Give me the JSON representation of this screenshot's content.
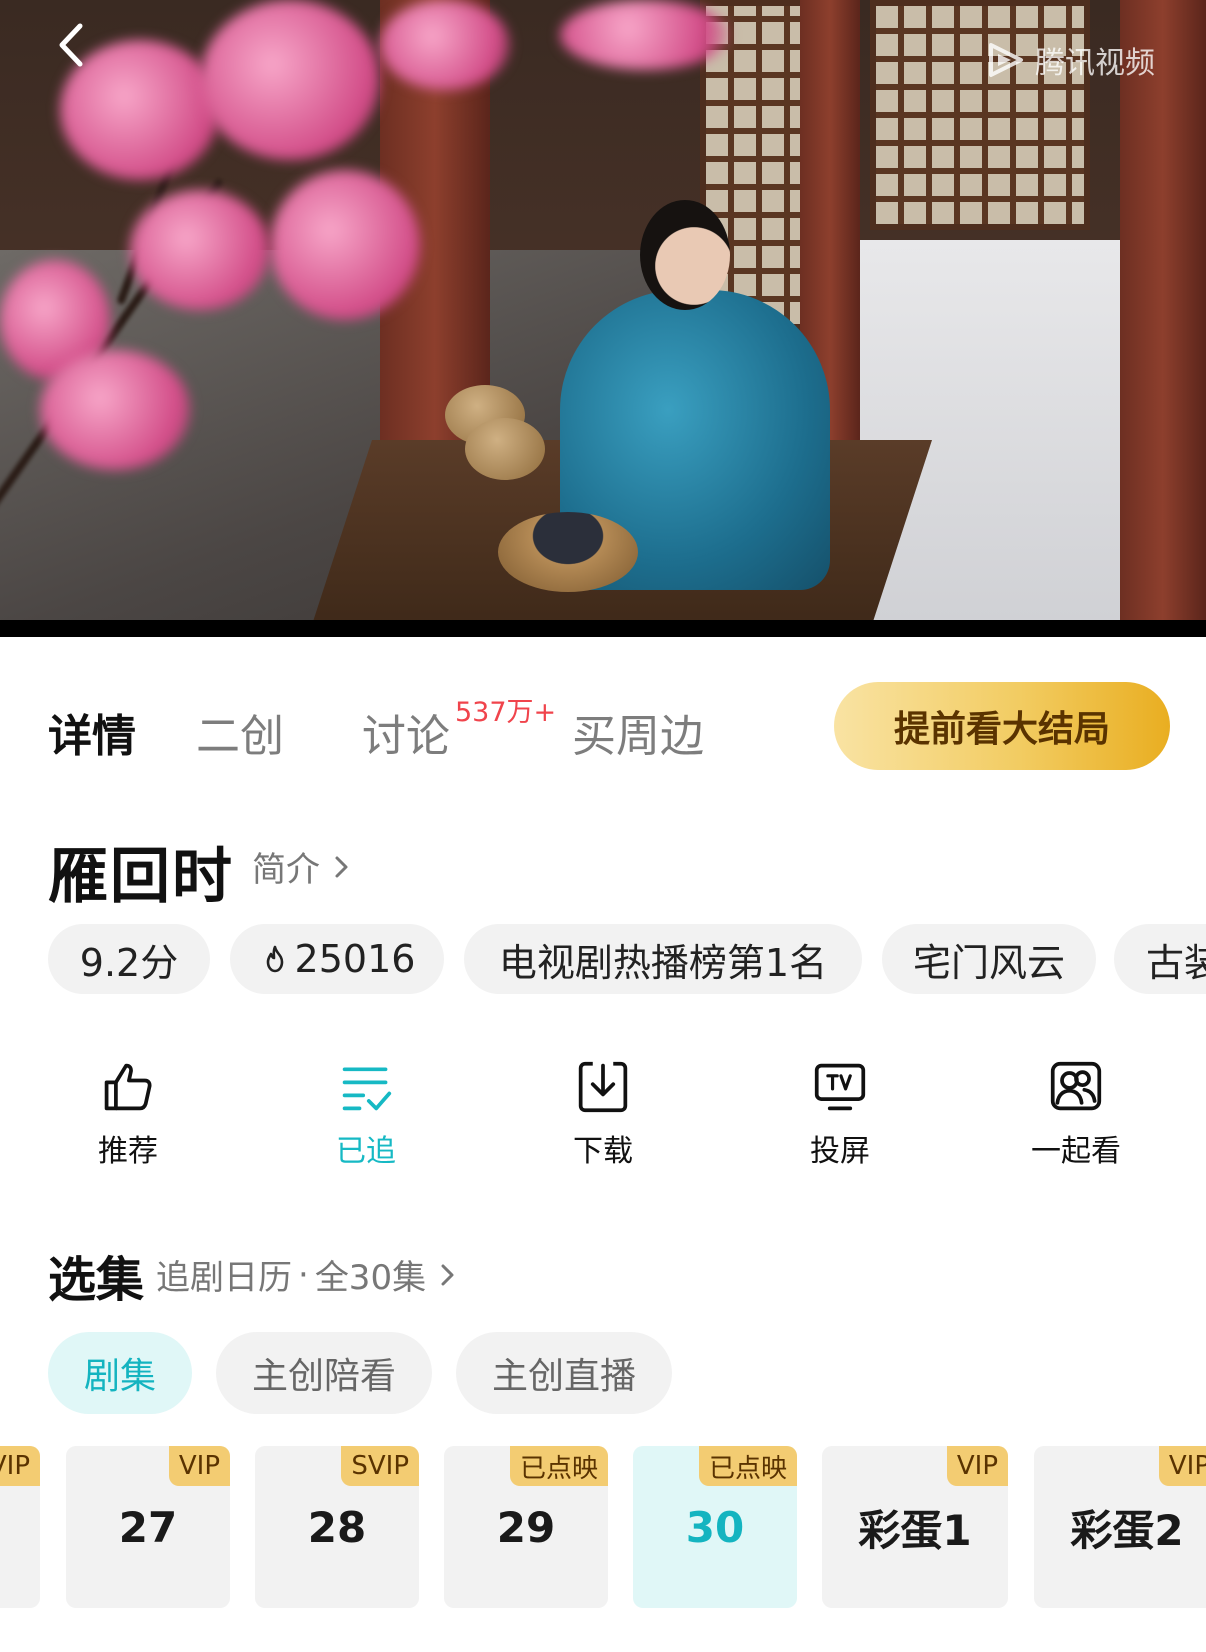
{
  "watermark": {
    "text": "腾讯视频"
  },
  "tabs": {
    "items": [
      {
        "label": "详情",
        "active": true
      },
      {
        "label": "二创"
      },
      {
        "label": "讨论",
        "badge": "537万+"
      },
      {
        "label": "买周边"
      }
    ],
    "cta": "提前看大结局"
  },
  "show": {
    "title": "雁回时",
    "intro_link": "简介"
  },
  "chips": [
    {
      "label": "9.2分"
    },
    {
      "label": "25016",
      "icon": "flame-icon"
    },
    {
      "label": "电视剧热播榜第1名"
    },
    {
      "label": "宅门风云"
    },
    {
      "label": "古装"
    }
  ],
  "actions": [
    {
      "label": "推荐",
      "icon": "thumbs-up-icon"
    },
    {
      "label": "已追",
      "icon": "followed-list-icon",
      "active_color": "#16b9c4"
    },
    {
      "label": "下载",
      "icon": "download-icon"
    },
    {
      "label": "投屏",
      "icon": "tv-cast-icon"
    },
    {
      "label": "一起看",
      "icon": "watch-together-icon"
    }
  ],
  "episodes_section": {
    "title": "选集",
    "calendar": "追剧日历",
    "separator": "·",
    "total": "全30集",
    "pills": [
      {
        "label": "剧集",
        "active": true
      },
      {
        "label": "主创陪看"
      },
      {
        "label": "主创直播"
      }
    ],
    "episodes": [
      {
        "label": "",
        "badge": "VIP"
      },
      {
        "label": "27",
        "badge": "VIP"
      },
      {
        "label": "28",
        "badge": "SVIP"
      },
      {
        "label": "29",
        "badge": "已点映"
      },
      {
        "label": "30",
        "badge": "已点映",
        "current": true
      },
      {
        "label": "彩蛋1",
        "badge": "VIP"
      },
      {
        "label": "彩蛋2",
        "badge": "VIP"
      }
    ]
  },
  "colors": {
    "accent": "#16b9c4",
    "badge_gold": "#f3cc72",
    "cta_gold": "#e9ae21",
    "discussion_badge": "#f0444c"
  }
}
